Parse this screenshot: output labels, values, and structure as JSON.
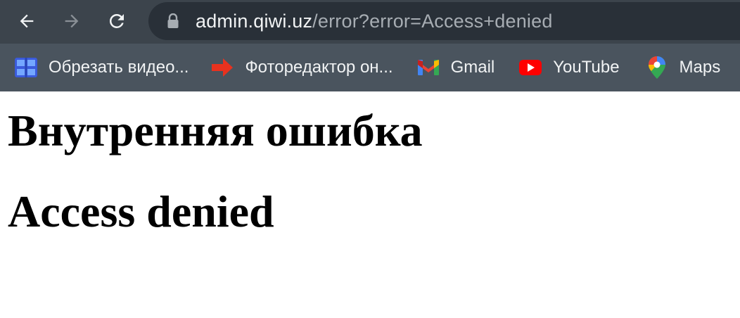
{
  "browser": {
    "url_host": "admin.qiwi.uz",
    "url_path": "/error?error=Access+denied",
    "bookmarks": [
      {
        "label": "Обрезать видео...",
        "icon": "video-trim-icon"
      },
      {
        "label": "Фоторедактор он...",
        "icon": "red-arrow-icon"
      },
      {
        "label": "Gmail",
        "icon": "gmail-icon"
      },
      {
        "label": "YouTube",
        "icon": "youtube-icon"
      },
      {
        "label": "Maps",
        "icon": "maps-pin-icon"
      }
    ],
    "colors": {
      "toolbar": "#3c444c",
      "omnibox": "#293038",
      "bookmarks_bar": "#4a545e",
      "text": "#f1f3f4"
    }
  },
  "page": {
    "error_title": "Внутренняя ошибка",
    "error_message": "Access denied"
  }
}
